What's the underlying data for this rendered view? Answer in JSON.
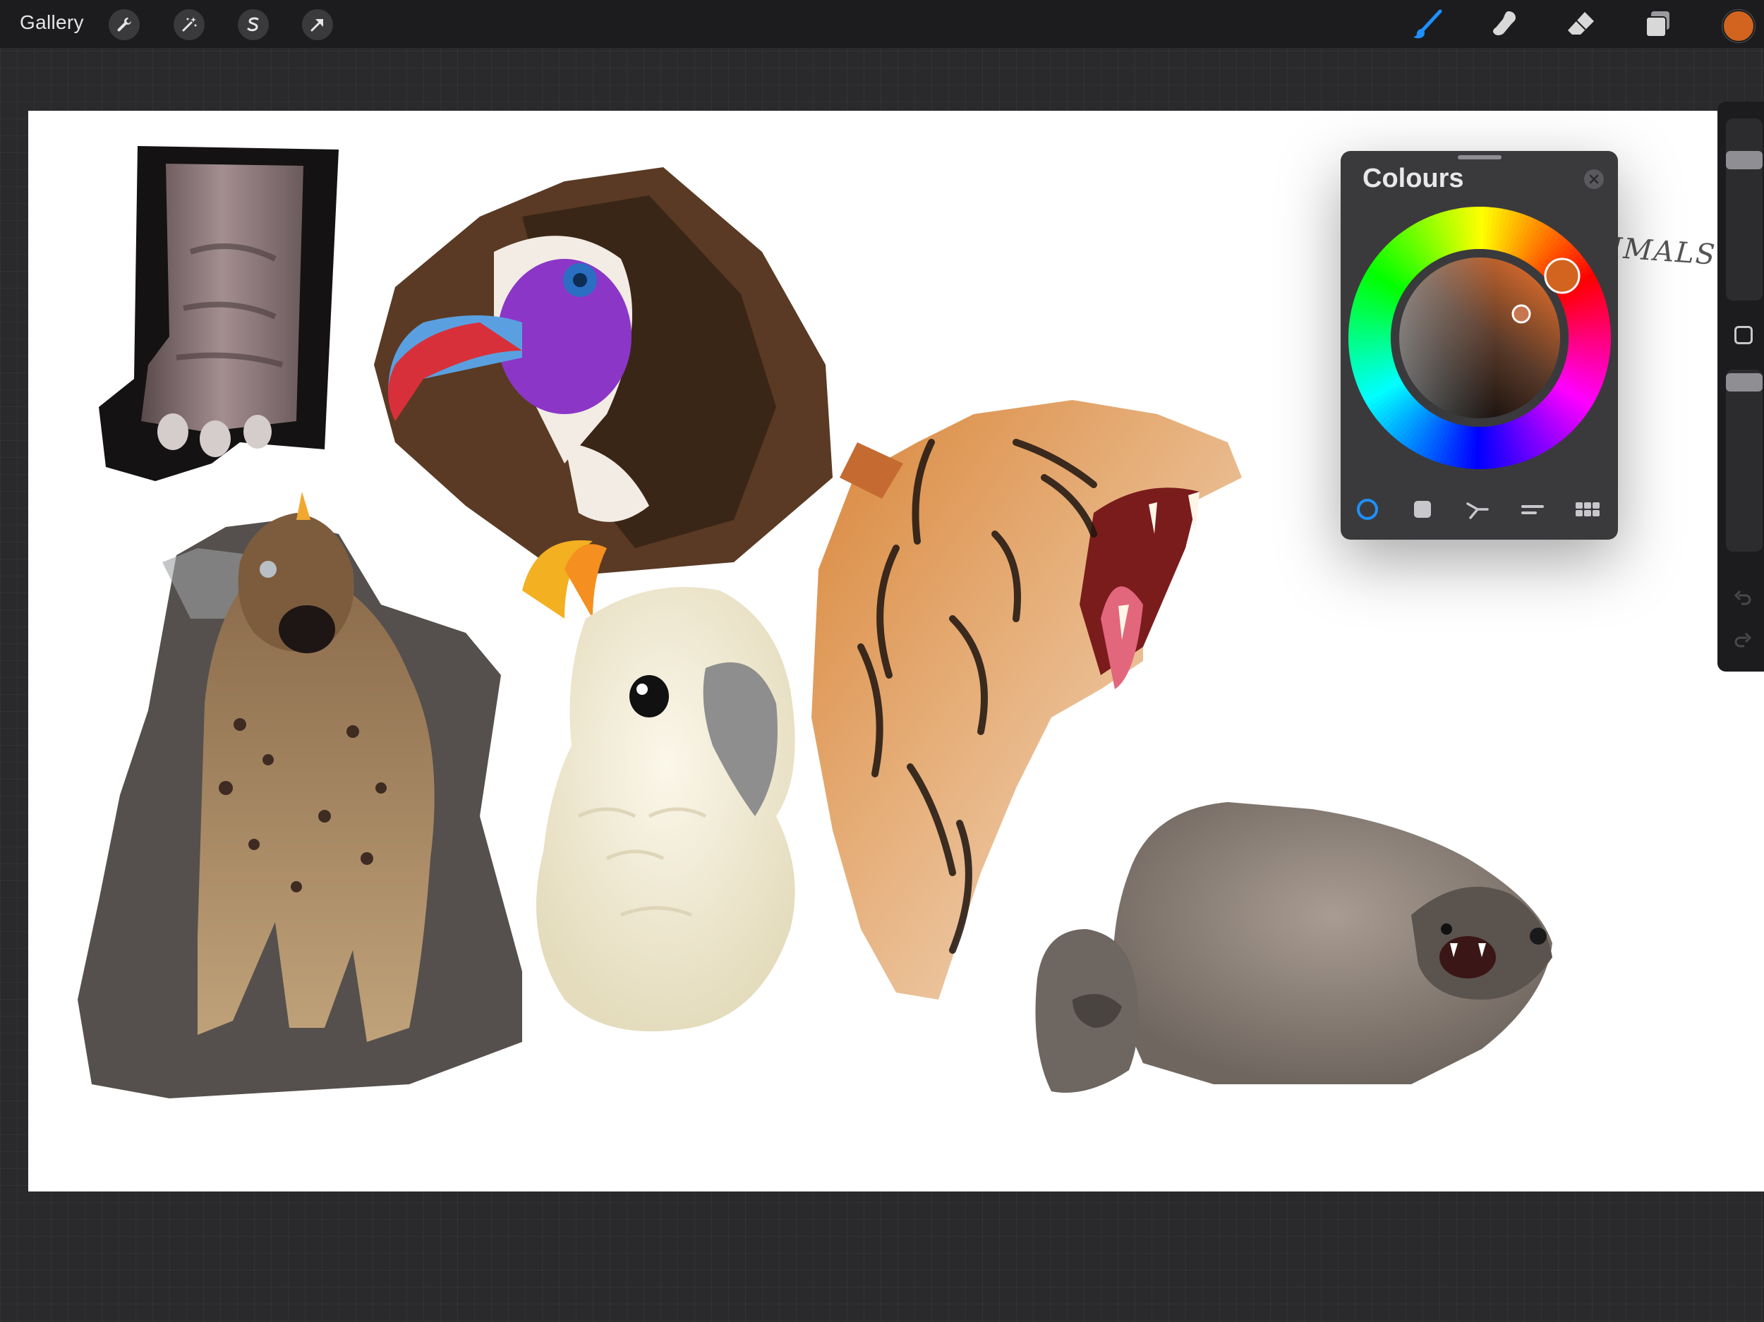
{
  "toolbar": {
    "gallery_label": "Gallery",
    "left_tools": [
      "wrench-icon",
      "magic-wand-icon",
      "selection-s-icon",
      "transform-arrow-icon"
    ],
    "right_tools": [
      "brush-icon",
      "smudge-icon",
      "eraser-icon",
      "layers-icon"
    ],
    "active_tool": "brush-icon",
    "active_colour": "#d2641f",
    "accent": "#1e90ff"
  },
  "canvas": {
    "annotation": "ANIMALS!",
    "background": "#ffffff",
    "subjects": [
      "elephant-foot",
      "vulture-head",
      "tiger-head",
      "hyena",
      "cockatoo",
      "hyrax-pair"
    ]
  },
  "colours_panel": {
    "title": "Colours",
    "mode": "disc",
    "tabs": [
      "disc-tab",
      "classic-tab",
      "harmony-tab",
      "value-tab",
      "palettes-tab"
    ],
    "selected_colour": "#d2641f"
  },
  "sidebar": {
    "brush_size_level": 0.2,
    "opacity_level": 0.02
  }
}
